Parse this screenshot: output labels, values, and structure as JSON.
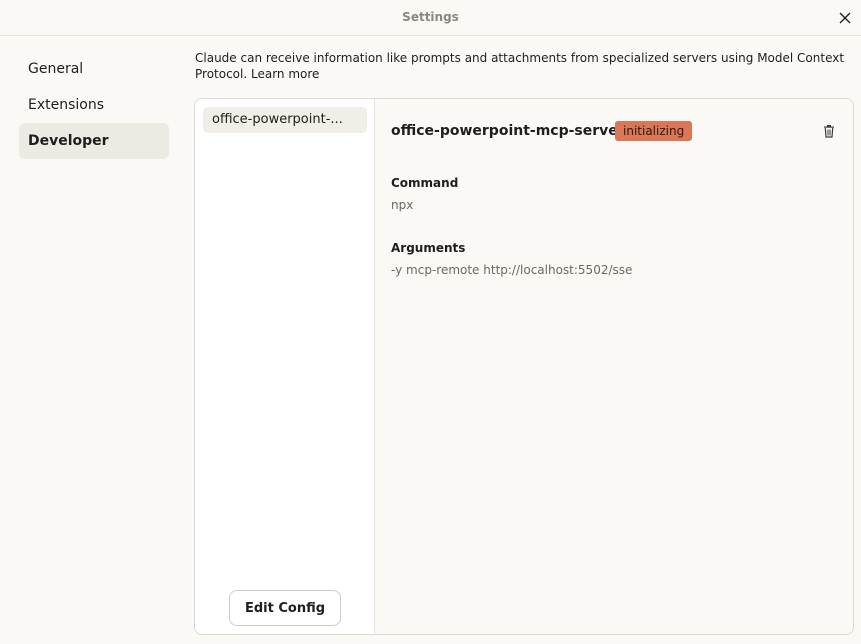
{
  "window": {
    "title": "Settings",
    "close_icon": "close-icon"
  },
  "sidebar": {
    "items": [
      {
        "label": "General",
        "active": false
      },
      {
        "label": "Extensions",
        "active": false
      },
      {
        "label": "Developer",
        "active": true
      }
    ]
  },
  "developer": {
    "description": "Claude can receive information like prompts and attachments from specialized servers using Model Context Protocol.",
    "learn_more": "Learn more",
    "servers": [
      {
        "label": "office-powerpoint-..."
      }
    ],
    "edit_config_label": "Edit Config",
    "selected": {
      "name": "office-powerpoint-mcp-server",
      "status": "initializing",
      "status_color": "#d97757",
      "command_label": "Command",
      "command_value": "npx",
      "arguments_label": "Arguments",
      "arguments_value": "-y mcp-remote http://localhost:5502/sse",
      "delete_icon": "trash-icon"
    }
  }
}
